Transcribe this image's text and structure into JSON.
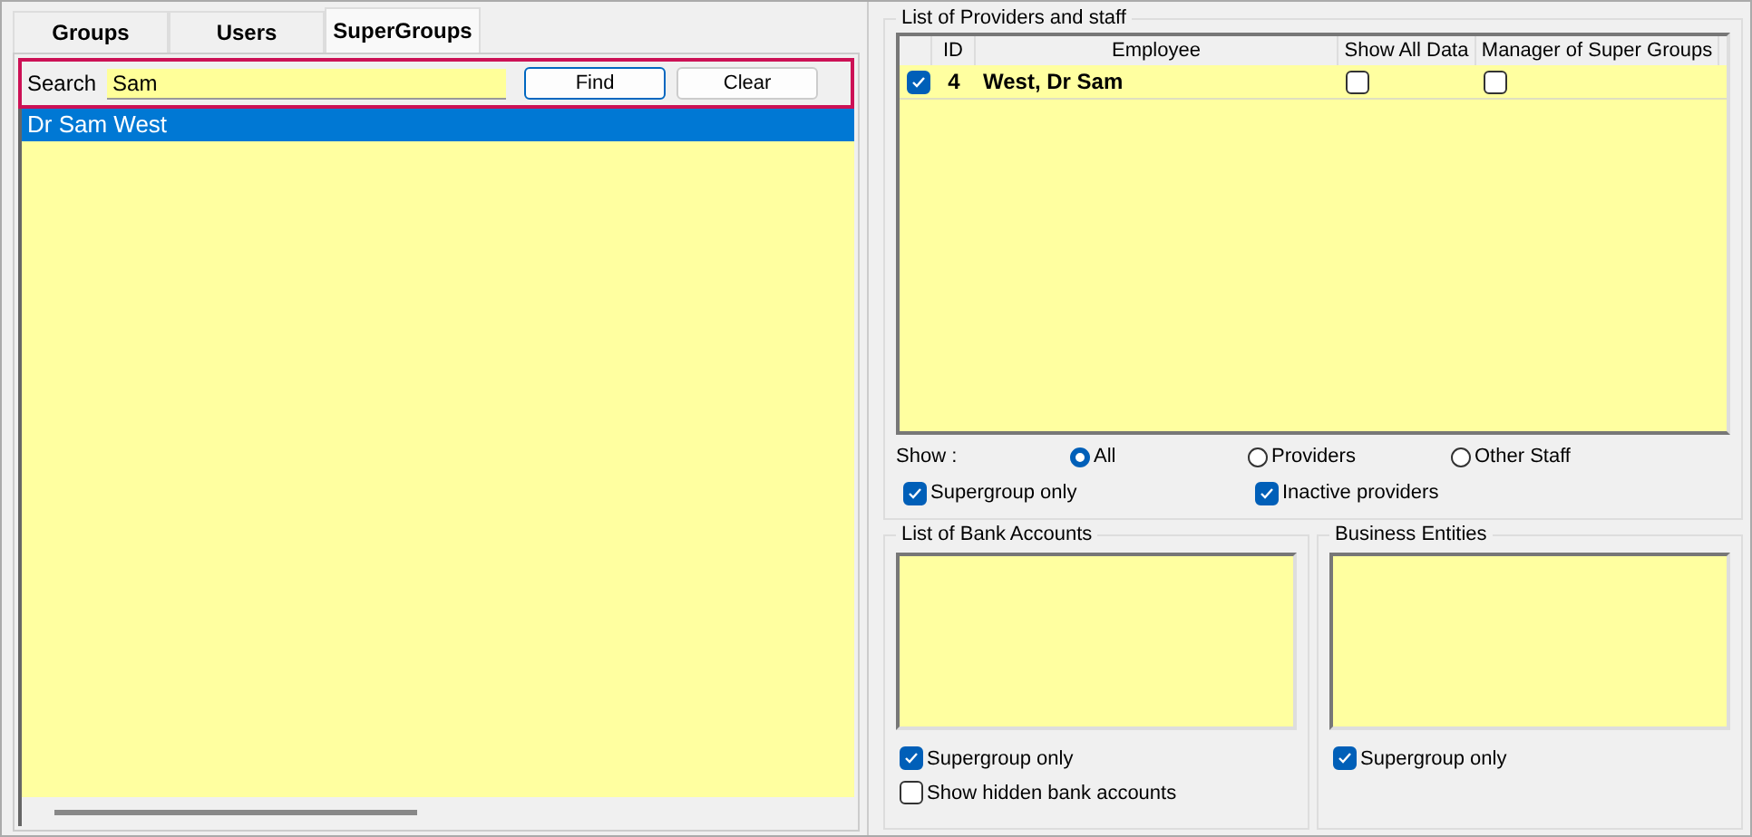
{
  "tabs": [
    {
      "label": "Groups",
      "selected": false
    },
    {
      "label": "Users",
      "selected": false
    },
    {
      "label": "SuperGroups",
      "selected": true
    }
  ],
  "search": {
    "label": "Search",
    "value": "Sam",
    "buttons": [
      {
        "label": "Find",
        "focused": true
      },
      {
        "label": "Clear",
        "focused": false
      }
    ]
  },
  "results": [
    {
      "label": "Dr Sam West",
      "selected": true
    }
  ],
  "providers": {
    "title": "List of Providers and staff",
    "columns": [
      "ID",
      "Employee",
      "Show All Data",
      "Manager of Super Groups"
    ],
    "rows": [
      {
        "checked": true,
        "id": "4",
        "employee": "West, Dr Sam",
        "show_all_data": false,
        "manager": false
      }
    ]
  },
  "show": {
    "label": "Show :",
    "options": [
      {
        "label": "All",
        "selected": true
      },
      {
        "label": "Providers",
        "selected": false
      },
      {
        "label": "Other Staff",
        "selected": false
      }
    ]
  },
  "filters": [
    {
      "label": "Supergroup only",
      "checked": true
    },
    {
      "label": "Inactive providers",
      "checked": true
    }
  ],
  "bank_accounts": {
    "title": "List of Bank Accounts",
    "options": [
      {
        "label": "Supergroup only",
        "checked": true
      },
      {
        "label": "Show hidden bank accounts",
        "checked": false
      }
    ]
  },
  "business_entities": {
    "title": "Business Entities",
    "options": [
      {
        "label": "Supergroup only",
        "checked": true
      }
    ]
  }
}
